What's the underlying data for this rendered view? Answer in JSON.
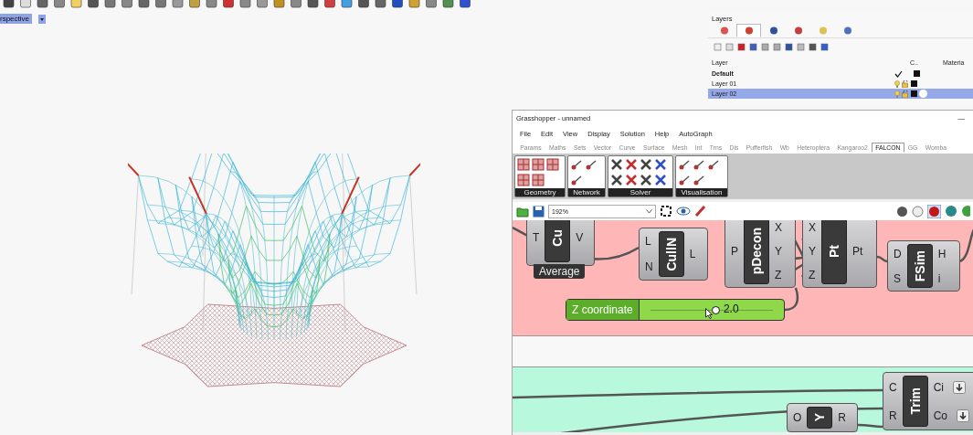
{
  "viewport": {
    "label": "rspective"
  },
  "layers_panel": {
    "title": "Layers",
    "tabs": [
      {
        "selected": false
      },
      {
        "selected": true
      },
      {
        "selected": false
      },
      {
        "selected": false
      },
      {
        "selected": false
      },
      {
        "selected": false
      }
    ],
    "columns": [
      "Layer",
      "C..",
      "Materia"
    ],
    "rows": [
      {
        "name": "Default",
        "current": true,
        "selected": false,
        "material": false
      },
      {
        "name": "Layer 01",
        "current": false,
        "selected": false,
        "material": false
      },
      {
        "name": "Layer 02",
        "current": false,
        "selected": true,
        "material": true
      }
    ]
  },
  "grasshopper": {
    "title": "Grasshopper - unnamed",
    "minimize": "—",
    "menu": [
      "File",
      "Edit",
      "View",
      "Display",
      "Solution",
      "Help",
      "AutoGraph"
    ],
    "tabs": [
      {
        "label": "Params",
        "selected": false
      },
      {
        "label": "Maths",
        "selected": false
      },
      {
        "label": "Sets",
        "selected": false
      },
      {
        "label": "Vector",
        "selected": false
      },
      {
        "label": "Curve",
        "selected": false
      },
      {
        "label": "Surface",
        "selected": false
      },
      {
        "label": "Mesh",
        "selected": false
      },
      {
        "label": "Int",
        "selected": false
      },
      {
        "label": "Trns",
        "selected": false
      },
      {
        "label": "Dis",
        "selected": false
      },
      {
        "label": "Pufferfish",
        "selected": false
      },
      {
        "label": "Wb",
        "selected": false
      },
      {
        "label": "Heteroptera",
        "selected": false
      },
      {
        "label": "Kangaroo2",
        "selected": false
      },
      {
        "label": "FALCON",
        "selected": true
      },
      {
        "label": "GG",
        "selected": false
      },
      {
        "label": "Womba",
        "selected": false
      }
    ],
    "ribbon_groups": [
      {
        "label": "Geometry"
      },
      {
        "label": "Network"
      },
      {
        "label": "Solver"
      },
      {
        "label": "Visualisation"
      }
    ],
    "zoom": "192%",
    "nodes": [
      {
        "kind": "component",
        "name": "Cu",
        "inputs": [
          "T"
        ],
        "outputs": [
          "V"
        ],
        "caption": "Average"
      },
      {
        "kind": "component",
        "name": "CullN",
        "inputs": [
          "L",
          "N"
        ],
        "outputs": [
          "L"
        ]
      },
      {
        "kind": "component",
        "name": "pDecon",
        "inputs": [
          "P"
        ],
        "outputs": [
          "X",
          "Y",
          "Z"
        ]
      },
      {
        "kind": "component",
        "name": "Pt",
        "inputs": [
          "X",
          "Y",
          "Z"
        ],
        "outputs": [
          "Pt"
        ]
      },
      {
        "kind": "component",
        "name": "FSim",
        "inputs": [
          "D",
          "S"
        ],
        "outputs": [
          "H",
          "i"
        ]
      },
      {
        "kind": "slider",
        "label": "Z coordinate",
        "value": "2.0",
        "level": 0.53
      },
      {
        "kind": "component",
        "name": "Trim",
        "inputs": [
          "C",
          "R"
        ],
        "outputs": [
          "Ci",
          "Co"
        ],
        "output_toggles": true
      },
      {
        "kind": "component",
        "name": "Y",
        "inputs": [
          "O"
        ],
        "outputs": [
          "R"
        ]
      }
    ]
  }
}
